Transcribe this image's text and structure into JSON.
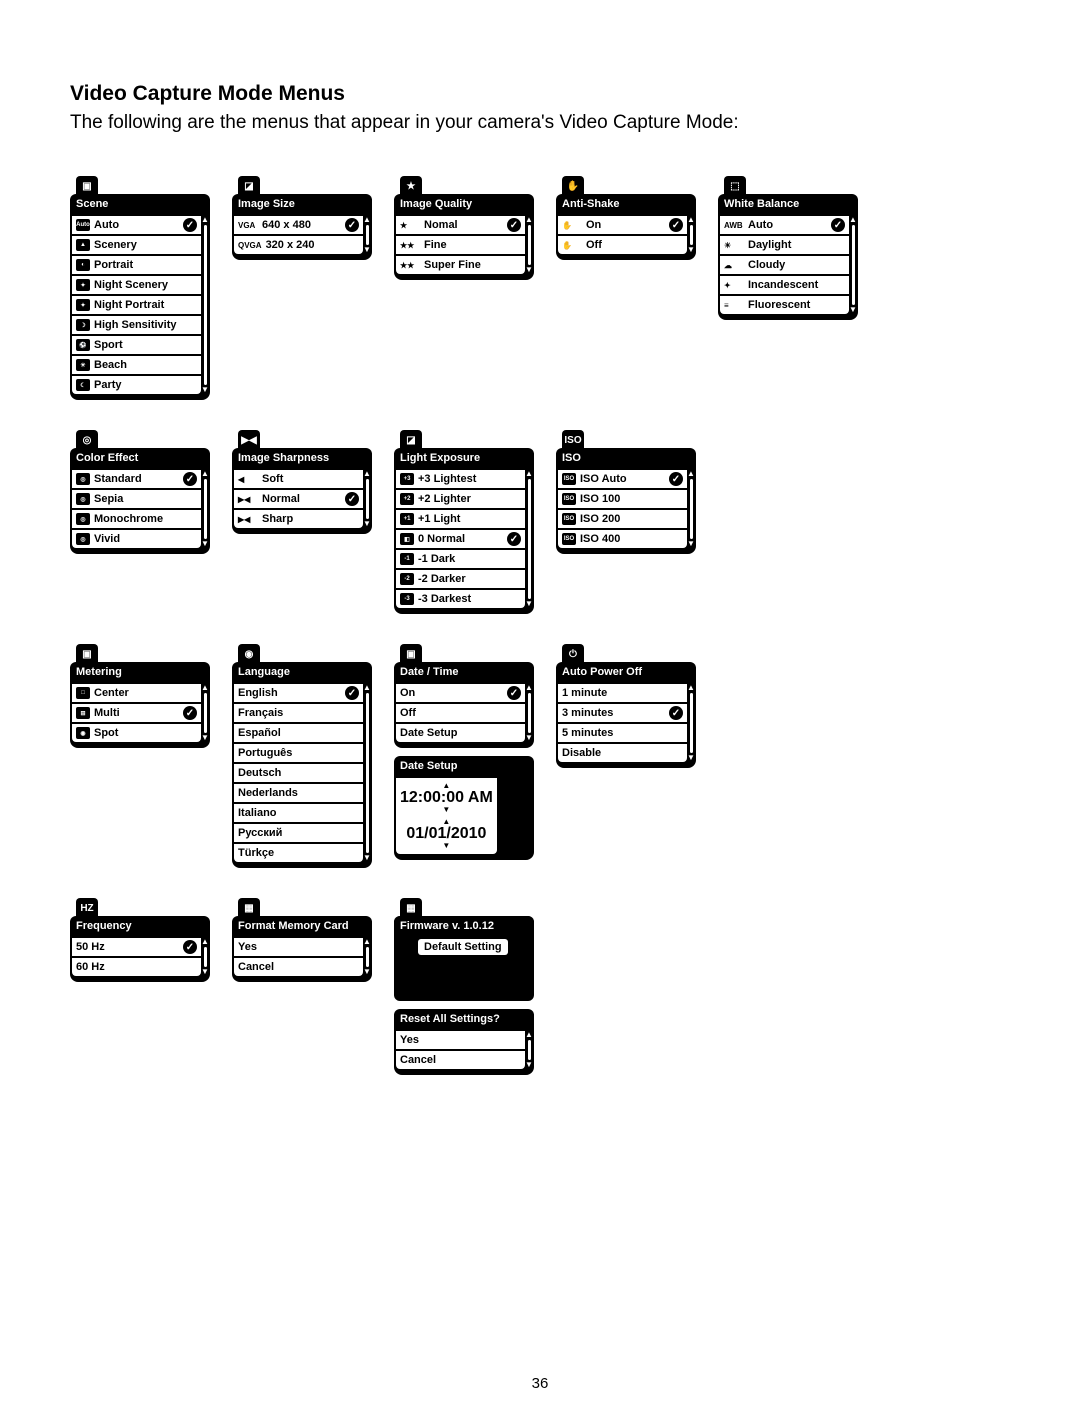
{
  "title": "Video Capture Mode Menus",
  "intro": "The following are the menus that appear in your camera's Video Capture Mode:",
  "page_number": "36",
  "menus": {
    "scene": {
      "tab_icon": "▣",
      "header": "Scene",
      "items": [
        {
          "icon": "Auto",
          "label": "Auto",
          "selected": true
        },
        {
          "icon": "▲",
          "label": "Scenery"
        },
        {
          "icon": "◐",
          "label": "Portrait"
        },
        {
          "icon": "✦",
          "label": "Night Scenery"
        },
        {
          "icon": "✦",
          "label": "Night Portrait"
        },
        {
          "icon": "☽",
          "label": "High Sensitivity"
        },
        {
          "icon": "⚽",
          "label": "Sport"
        },
        {
          "icon": "☀",
          "label": "Beach"
        },
        {
          "icon": "☾",
          "label": "Party"
        }
      ]
    },
    "image_size": {
      "tab_icon": "◪",
      "header": "Image Size",
      "items": [
        {
          "prefix": "VGA",
          "label": "640 x 480",
          "selected": true
        },
        {
          "prefix": "QVGA",
          "label": "320 x 240"
        }
      ]
    },
    "image_quality": {
      "tab_icon": "★",
      "header": "Image Quality",
      "items": [
        {
          "prefix": "★",
          "label": "Nomal",
          "selected": true
        },
        {
          "prefix": "★★",
          "label": "Fine"
        },
        {
          "prefix": "★★",
          "label": "Super Fine"
        }
      ]
    },
    "anti_shake": {
      "tab_icon": "✋",
      "header": "Anti-Shake",
      "items": [
        {
          "prefix": "✋",
          "label": "On",
          "selected": true
        },
        {
          "prefix": "✋",
          "label": "Off"
        }
      ]
    },
    "white_balance": {
      "tab_icon": "⬚",
      "header": "White Balance",
      "items": [
        {
          "prefix": "AWB",
          "label": "Auto",
          "selected": true
        },
        {
          "prefix": "☀",
          "label": "Daylight"
        },
        {
          "prefix": "☁",
          "label": "Cloudy"
        },
        {
          "prefix": "✦",
          "label": "Incandescent"
        },
        {
          "prefix": "≡",
          "label": "Fluorescent"
        }
      ]
    },
    "color_effect": {
      "tab_icon": "◎",
      "header": "Color Effect",
      "items": [
        {
          "icon": "◎",
          "label": "Standard",
          "selected": true
        },
        {
          "icon": "◎",
          "label": "Sepia"
        },
        {
          "icon": "◎",
          "label": "Monochrome"
        },
        {
          "icon": "◎",
          "label": "Vivid"
        }
      ]
    },
    "image_sharpness": {
      "tab_icon": "▶◀",
      "header": "Image Sharpness",
      "items": [
        {
          "prefix": "◀",
          "label": "Soft"
        },
        {
          "prefix": "▶◀",
          "label": "Normal",
          "selected": true
        },
        {
          "prefix": "▶◀",
          "label": "Sharp"
        }
      ]
    },
    "light_exposure": {
      "tab_icon": "◪",
      "header": "Light Exposure",
      "items": [
        {
          "icon": "+3",
          "label": "+3 Lightest"
        },
        {
          "icon": "+2",
          "label": "+2 Lighter"
        },
        {
          "icon": "+1",
          "label": "+1 Light"
        },
        {
          "icon": "◧",
          "label": "0 Normal",
          "selected": true
        },
        {
          "icon": "-1",
          "label": "-1 Dark"
        },
        {
          "icon": "-2",
          "label": "-2 Darker"
        },
        {
          "icon": "-3",
          "label": "-3 Darkest"
        }
      ]
    },
    "iso": {
      "tab_icon": "ISO",
      "header": "ISO",
      "items": [
        {
          "icon": "ISO",
          "label": "ISO Auto",
          "selected": true
        },
        {
          "icon": "ISO",
          "label": "ISO 100"
        },
        {
          "icon": "ISO",
          "label": "ISO 200"
        },
        {
          "icon": "ISO",
          "label": "ISO 400"
        }
      ]
    },
    "metering": {
      "tab_icon": "▣",
      "header": "Metering",
      "items": [
        {
          "icon": "□",
          "label": "Center"
        },
        {
          "icon": "⊞",
          "label": "Multi",
          "selected": true
        },
        {
          "icon": "◉",
          "label": "Spot"
        }
      ]
    },
    "language": {
      "tab_icon": "◉",
      "header": "Language",
      "items": [
        {
          "label": "English",
          "selected": true
        },
        {
          "label": "Français"
        },
        {
          "label": "Español"
        },
        {
          "label": "Português"
        },
        {
          "label": "Deutsch"
        },
        {
          "label": "Nederlands"
        },
        {
          "label": "Italiano"
        },
        {
          "label": "Русский"
        },
        {
          "label": "Türkçe"
        }
      ]
    },
    "date_time": {
      "tab_icon": "▣",
      "header": "Date / Time",
      "items": [
        {
          "label": "On",
          "selected": true
        },
        {
          "label": "Off"
        },
        {
          "label": "Date Setup"
        }
      ]
    },
    "date_setup": {
      "header": "Date Setup",
      "time": "12:00:00 AM",
      "date": "01/01/2010"
    },
    "auto_power_off": {
      "tab_icon": "⏻",
      "header": "Auto Power Off",
      "items": [
        {
          "label": "1 minute"
        },
        {
          "label": "3 minutes",
          "selected": true
        },
        {
          "label": "5 minutes"
        },
        {
          "label": "Disable"
        }
      ]
    },
    "frequency": {
      "tab_icon": "HZ",
      "header": "Frequency",
      "items": [
        {
          "label": "50 Hz",
          "selected": true
        },
        {
          "label": "60 Hz"
        }
      ]
    },
    "format_memory": {
      "tab_icon": "▦",
      "header": "Format Memory Card",
      "items": [
        {
          "label": "Yes"
        },
        {
          "label": "Cancel"
        }
      ]
    },
    "firmware": {
      "tab_icon": "▦",
      "header": "Firmware v. 1.0.12",
      "default": "Default Setting"
    },
    "reset_all": {
      "header": "Reset All Settings?",
      "items": [
        {
          "label": "Yes"
        },
        {
          "label": "Cancel"
        }
      ]
    }
  }
}
